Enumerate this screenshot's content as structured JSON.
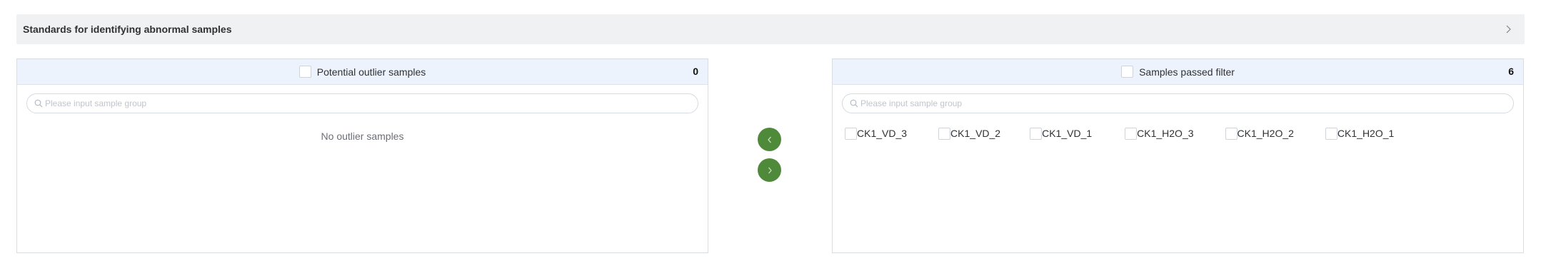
{
  "collapse": {
    "title": "Standards for identifying abnormal samples",
    "arrow_icon": "chevron-right-icon"
  },
  "left_panel": {
    "title": "Potential outlier samples",
    "count": "0",
    "search_placeholder": "Please input sample group",
    "empty_text": "No outlier samples"
  },
  "right_panel": {
    "title": "Samples passed filter",
    "count": "6",
    "search_placeholder": "Please input sample group",
    "samples": [
      {
        "label": "CK1_VD_3"
      },
      {
        "label": "CK1_VD_2"
      },
      {
        "label": "CK1_VD_1"
      },
      {
        "label": "CK1_H2O_3"
      },
      {
        "label": "CK1_H2O_2"
      },
      {
        "label": "CK1_H2O_1"
      }
    ]
  },
  "transfer": {
    "to_left_icon": "chevron-left-icon",
    "to_right_icon": "chevron-right-icon",
    "button_color": "#4f8a3a"
  }
}
